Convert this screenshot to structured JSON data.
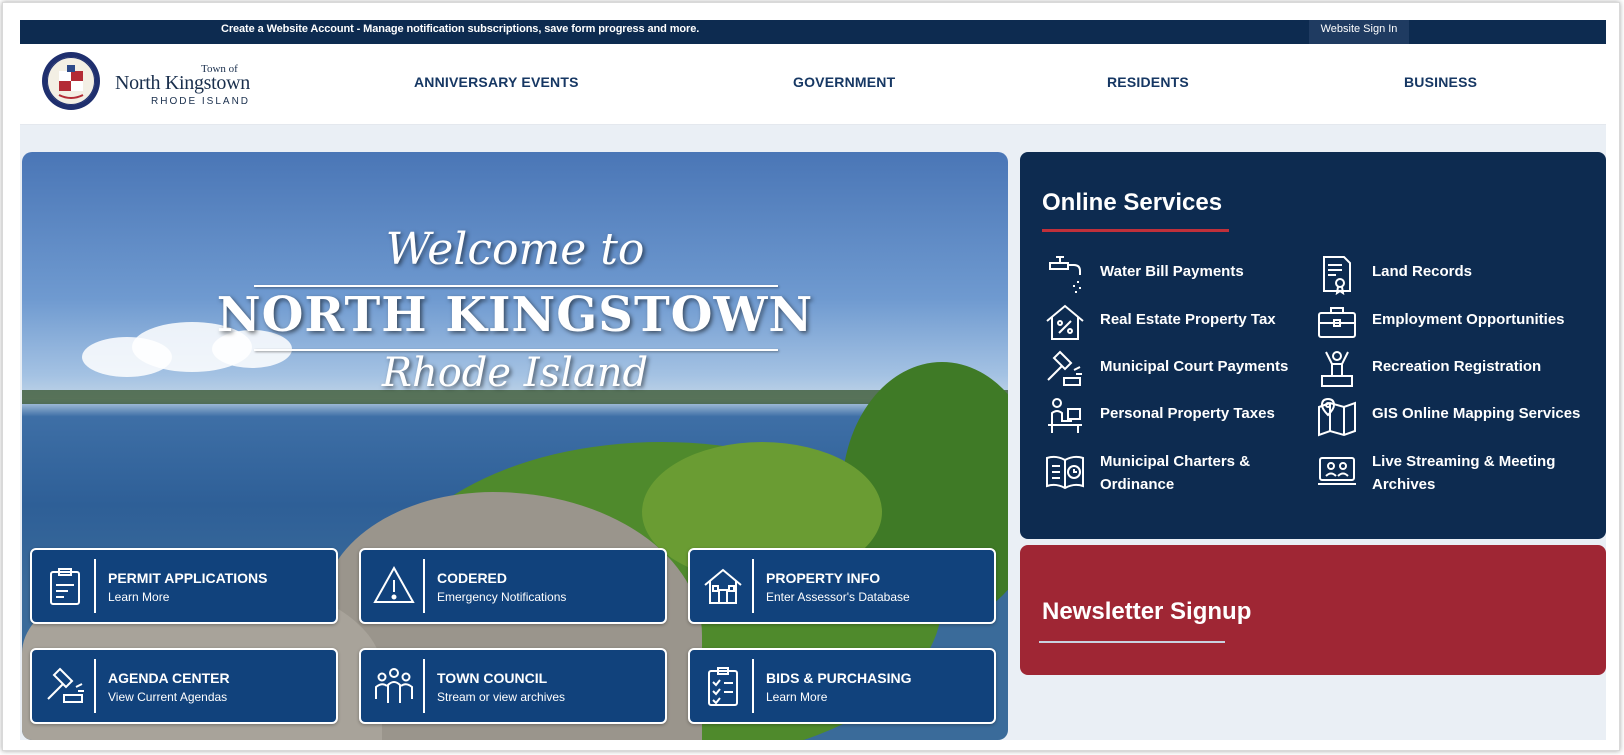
{
  "topbar": {
    "message": "Create a Website Account - Manage notification subscriptions, save form progress and more.",
    "sign_in": "Website Sign In"
  },
  "brand": {
    "town_of": "Town of",
    "name": "North Kingstown",
    "state": "RHODE ISLAND"
  },
  "nav": [
    {
      "label": "ANNIVERSARY EVENTS"
    },
    {
      "label": "GOVERNMENT"
    },
    {
      "label": "RESIDENTS"
    },
    {
      "label": "BUSINESS"
    }
  ],
  "hero": {
    "welcome": "Welcome to",
    "town": "NORTH KINGSTOWN",
    "state": "Rhode Island"
  },
  "tiles": [
    {
      "title": "PERMIT APPLICATIONS",
      "subtitle": "Learn More",
      "icon": "permit-clipboard-icon"
    },
    {
      "title": "CODERED",
      "subtitle": "Emergency Notifications",
      "icon": "warning-icon"
    },
    {
      "title": "PROPERTY INFO",
      "subtitle": "Enter Assessor's Database",
      "icon": "house-icon"
    },
    {
      "title": "AGENDA CENTER",
      "subtitle": "View Current Agendas",
      "icon": "gavel-icon"
    },
    {
      "title": "TOWN COUNCIL",
      "subtitle": "Stream or view archives",
      "icon": "people-group-icon"
    },
    {
      "title": "BIDS & PURCHASING",
      "subtitle": "Learn More",
      "icon": "checklist-icon"
    }
  ],
  "services": {
    "title": "Online Services",
    "items": [
      {
        "label": "Water Bill Payments",
        "icon": "faucet-icon"
      },
      {
        "label": "Land Records",
        "icon": "certificate-icon"
      },
      {
        "label": "Real Estate Property Tax",
        "icon": "house-percent-icon"
      },
      {
        "label": "Employment Opportunities",
        "icon": "briefcase-icon"
      },
      {
        "label": "Municipal Court Payments",
        "icon": "gavel-icon"
      },
      {
        "label": "Recreation Registration",
        "icon": "person-podium-icon"
      },
      {
        "label": "Personal Property Taxes",
        "icon": "person-desk-icon"
      },
      {
        "label": "GIS Online Mapping Services",
        "icon": "map-pin-icon"
      },
      {
        "label": "Municipal Charters & Ordinance",
        "icon": "book-clock-icon"
      },
      {
        "label": "Live Streaming & Meeting Archives",
        "icon": "video-meeting-icon"
      }
    ]
  },
  "newsletter": {
    "title": "Newsletter Signup"
  },
  "colors": {
    "navy": "#0d2b50",
    "tile_blue": "#11427c",
    "accent_red": "#c0303a",
    "newsletter_red": "#9f2634",
    "nav_text": "#163763"
  }
}
